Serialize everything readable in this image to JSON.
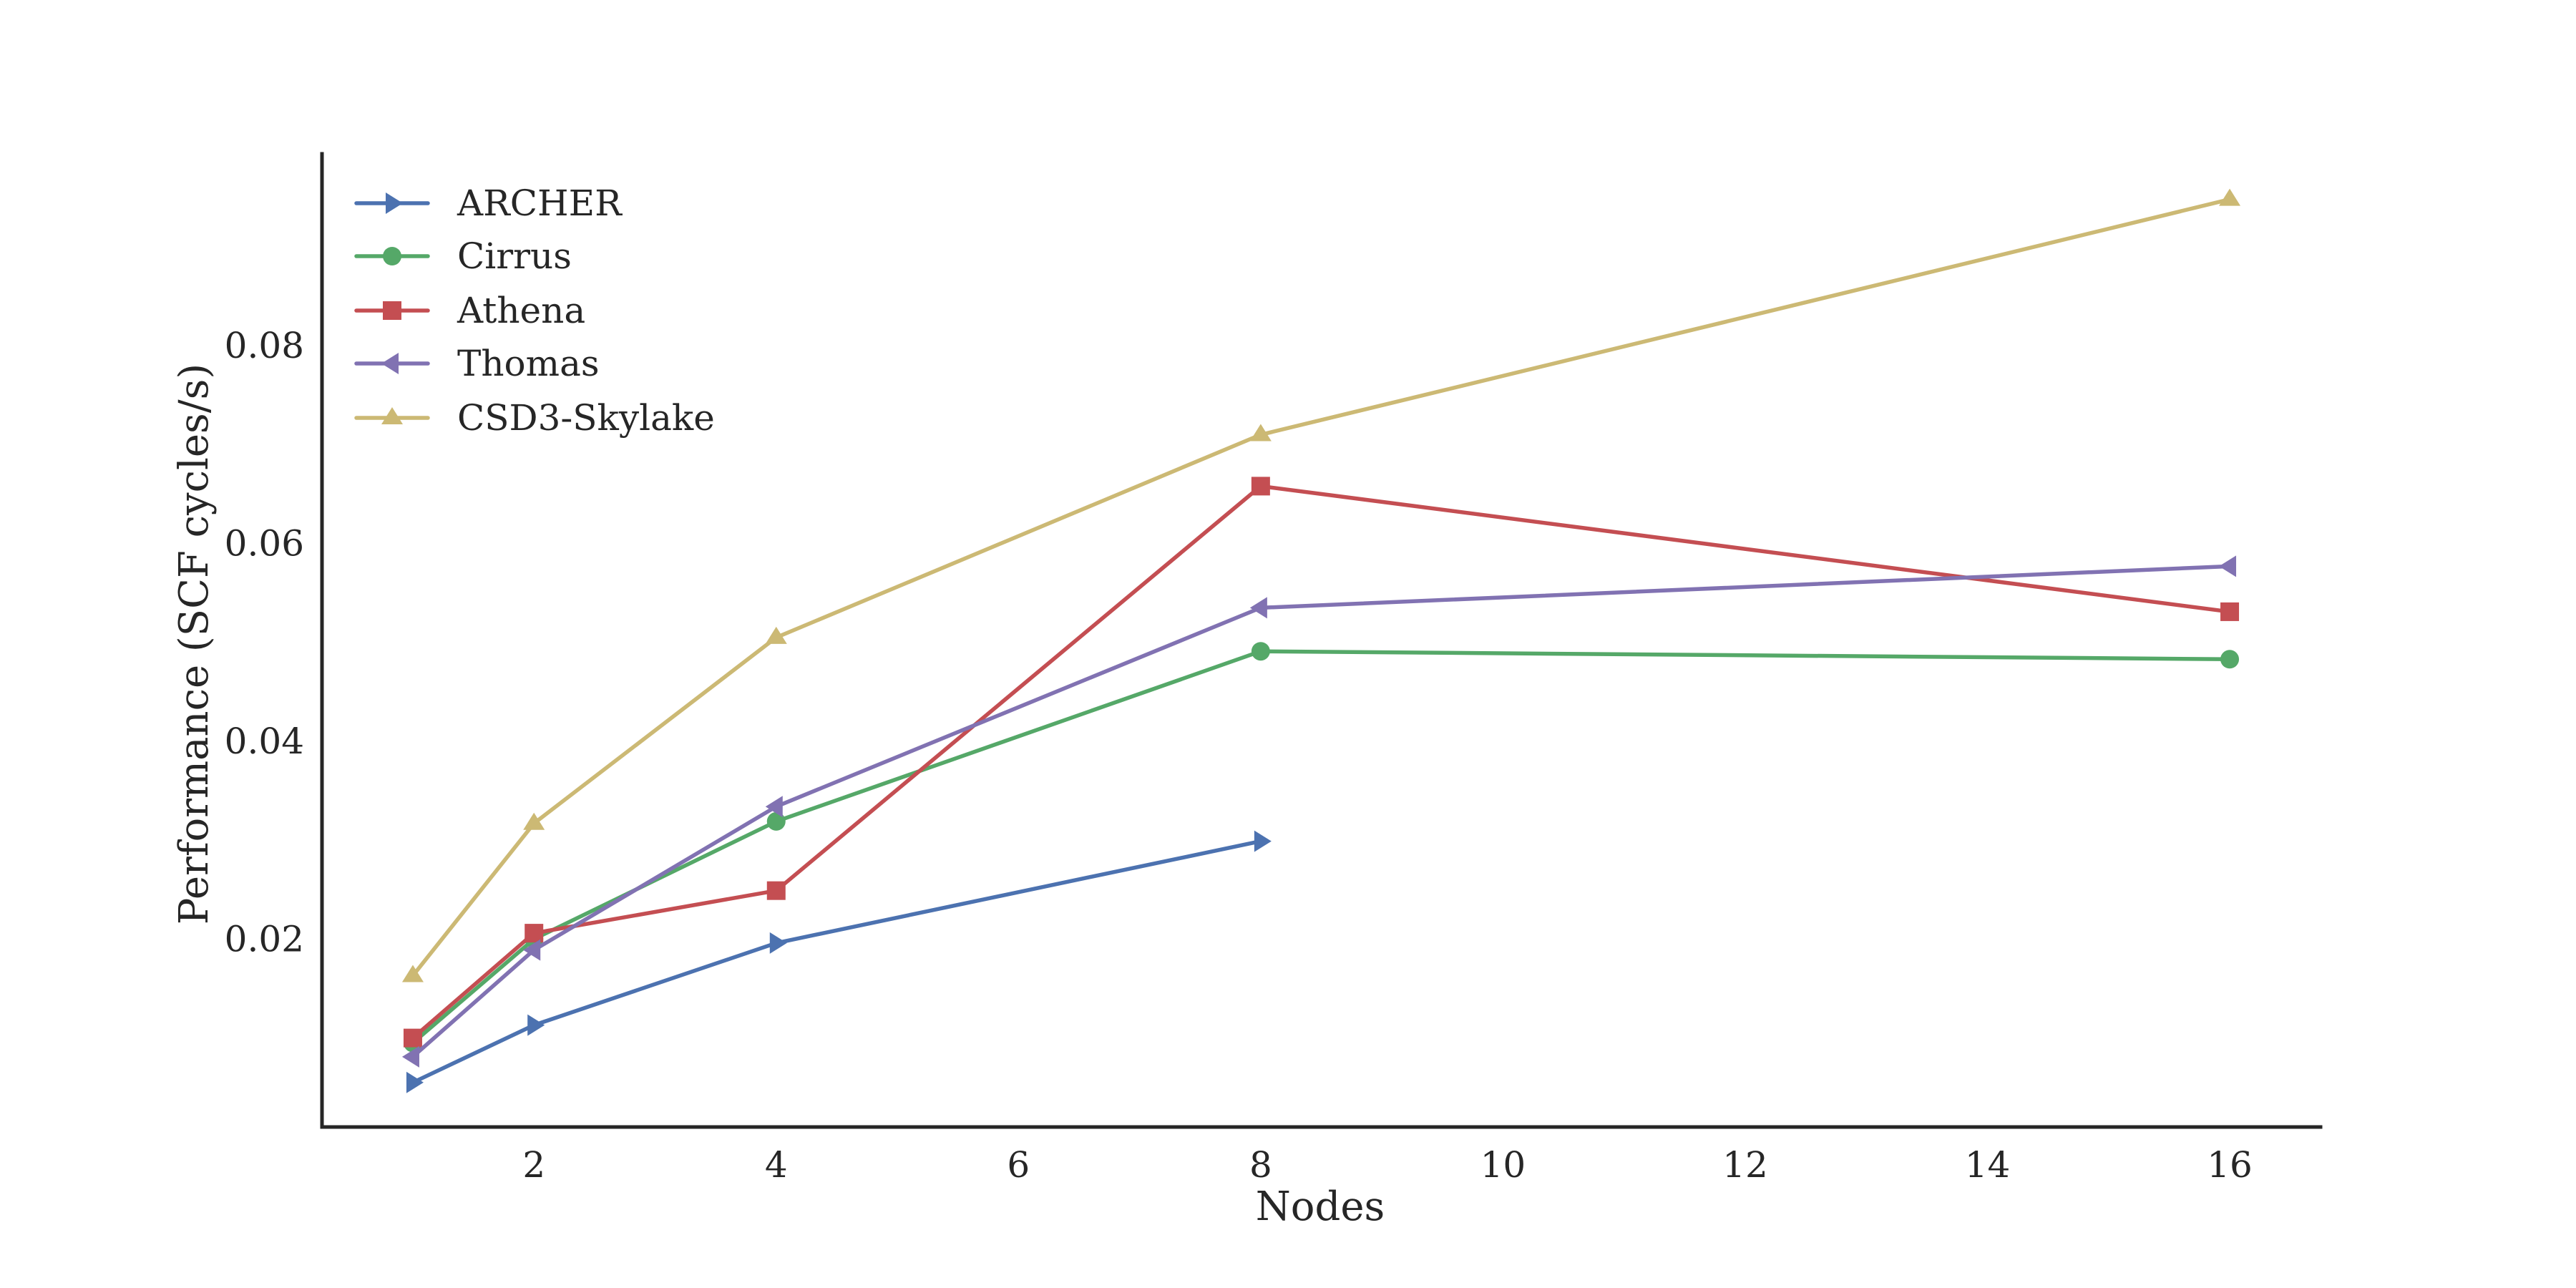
{
  "chart_data": {
    "type": "line",
    "title": "",
    "xlabel": "Nodes",
    "ylabel": "Performance (SCF cycles/s)",
    "xlim": [
      0.25,
      16.75
    ],
    "ylim": [
      0.001,
      0.0994
    ],
    "xticks": [
      2,
      4,
      6,
      8,
      10,
      12,
      14,
      16
    ],
    "xtick_labels": [
      "2",
      "4",
      "6",
      "8",
      "10",
      "12",
      "14",
      "16"
    ],
    "yticks": [
      0.02,
      0.04,
      0.06,
      0.08
    ],
    "ytick_labels": [
      "0.02",
      "0.04",
      "0.06",
      "0.08"
    ],
    "grid": false,
    "legend_position": "top-left",
    "series": [
      {
        "name": "ARCHER",
        "color": "#4c72b0",
        "marker": "triangle-right",
        "x": [
          1,
          2,
          4,
          8
        ],
        "values": [
          0.0055,
          0.0113,
          0.0196,
          0.0299
        ]
      },
      {
        "name": "Cirrus",
        "color": "#55a868",
        "marker": "circle",
        "x": [
          1,
          2,
          4,
          8,
          16
        ],
        "values": [
          0.0095,
          0.02,
          0.0319,
          0.0491,
          0.0483
        ]
      },
      {
        "name": "Athena",
        "color": "#c44e52",
        "marker": "square",
        "x": [
          1,
          2,
          4,
          8,
          16
        ],
        "values": [
          0.01,
          0.0206,
          0.0249,
          0.0658,
          0.0531
        ]
      },
      {
        "name": "Thomas",
        "color": "#8172b2",
        "marker": "triangle-left",
        "x": [
          1,
          2,
          4,
          8,
          16
        ],
        "values": [
          0.0081,
          0.0189,
          0.0334,
          0.0535,
          0.0577
        ]
      },
      {
        "name": "CSD3-Skylake",
        "color": "#ccb974",
        "marker": "triangle-up",
        "x": [
          1,
          2,
          4,
          8,
          16
        ],
        "values": [
          0.0163,
          0.0317,
          0.0505,
          0.071,
          0.0948
        ]
      }
    ]
  }
}
